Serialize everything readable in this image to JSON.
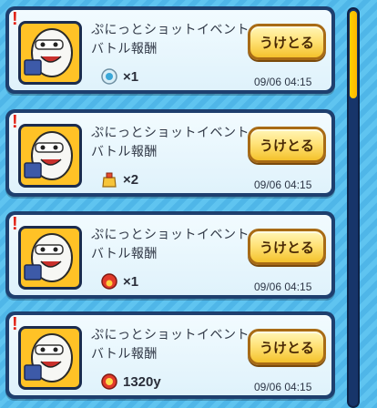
{
  "rewards": [
    {
      "title_line1": "ぷにっとショットイベント",
      "title_line2": "バトル報酬",
      "item_icon": "orb-icon",
      "amount": "×1",
      "button_label": "うけとる",
      "date": "09/06 04:15"
    },
    {
      "title_line1": "ぷにっとショットイベント",
      "title_line2": "バトル報酬",
      "item_icon": "bag-icon",
      "amount": "×2",
      "button_label": "うけとる",
      "date": "09/06 04:15"
    },
    {
      "title_line1": "ぷにっとショットイベント",
      "title_line2": "バトル報酬",
      "item_icon": "red-orb-icon",
      "amount": "×1",
      "button_label": "うけとる",
      "date": "09/06 04:15"
    },
    {
      "title_line1": "ぷにっとショットイベント",
      "title_line2": "バトル報酬",
      "item_icon": "money-icon",
      "amount": "1320y",
      "button_label": "うけとる",
      "date": "09/06 04:15"
    }
  ],
  "alert_mark": "!",
  "colors": {
    "card_border": "#1e3f6e",
    "button": "#ffe37a",
    "avatar_bg": "#ffc226",
    "scroll_thumb": "#ffd000"
  }
}
